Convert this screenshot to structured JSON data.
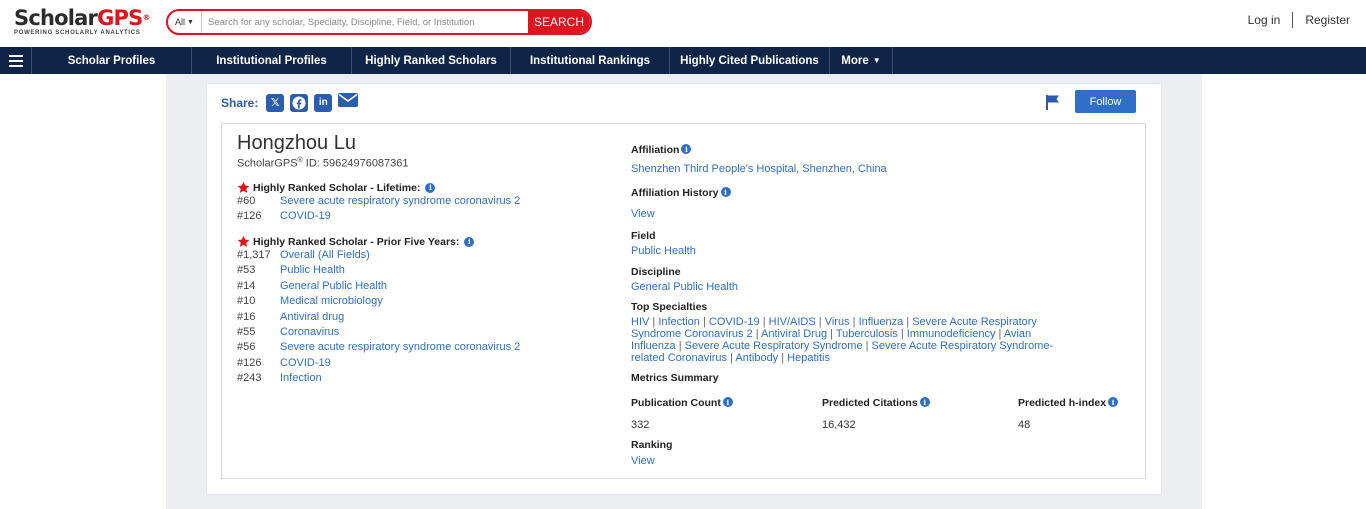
{
  "header": {
    "logo_scholar": "Scholar",
    "logo_gps": "GPS",
    "logo_reg": "®",
    "logo_tagline": "POWERING SCHOLARLY ANALYTICS",
    "search_category": "All",
    "search_placeholder": "Search for any scholar, Specialty, Discipline, Field, or Institution",
    "search_button": "SEARCH",
    "login": "Log in",
    "register": "Register"
  },
  "nav": {
    "items": [
      {
        "label": "Scholar Profiles"
      },
      {
        "label": "Institutional Profiles"
      },
      {
        "label": "Highly Ranked Scholars"
      },
      {
        "label": "Institutional Rankings"
      },
      {
        "label": "Highly Cited Publications"
      },
      {
        "label": "More"
      }
    ]
  },
  "share": {
    "label": "Share:",
    "follow": "Follow"
  },
  "profile": {
    "name": "Hongzhou Lu",
    "id_prefix": "ScholarGPS",
    "id_reg": "®",
    "id_rest": " ID: 59624976087361",
    "lifetime_heading": "Highly Ranked Scholar - Lifetime:",
    "lifetime": [
      {
        "rank": "#60",
        "topic": "Severe acute respiratory syndrome coronavirus 2"
      },
      {
        "rank": "#126",
        "topic": "COVID-19"
      }
    ],
    "prior_heading": "Highly Ranked Scholar - Prior Five Years:",
    "prior": [
      {
        "rank": "#1,317",
        "topic": "Overall (All Fields)"
      },
      {
        "rank": "#53",
        "topic": "Public Health"
      },
      {
        "rank": "#14",
        "topic": "General Public Health"
      },
      {
        "rank": "#10",
        "topic": "Medical microbiology"
      },
      {
        "rank": "#16",
        "topic": "Antiviral drug"
      },
      {
        "rank": "#55",
        "topic": "Coronavirus"
      },
      {
        "rank": "#56",
        "topic": "Severe acute respiratory syndrome coronavirus 2"
      },
      {
        "rank": "#126",
        "topic": "COVID-19"
      },
      {
        "rank": "#243",
        "topic": "Infection"
      }
    ]
  },
  "details": {
    "affiliation_label": "Affiliation",
    "affiliation": "Shenzhen Third People's Hospital, Shenzhen, China",
    "history_label": "Affiliation History",
    "history_link": "View",
    "field_label": "Field",
    "field": "Public Health",
    "discipline_label": "Discipline",
    "discipline": "General Public Health",
    "specialties_label": "Top Specialties",
    "specialties": [
      "HIV",
      "Infection",
      "COVID-19",
      "HIV/AIDS",
      "Virus",
      "Influenza",
      "Severe Acute Respiratory Syndrome Coronavirus 2",
      "Antiviral Drug",
      "Tuberculosis",
      "Immunodeficiency",
      "Avian Influenza",
      "Severe Acute Respiratory Syndrome",
      "Severe Acute Respiratory Syndrome-related Coronavirus",
      "Antibody",
      "Hepatitis"
    ],
    "metrics_label": "Metrics Summary",
    "pub_count_label": "Publication Count",
    "pub_count": "332",
    "pred_cit_label": "Predicted Citations",
    "pred_cit": "16,432",
    "pred_h_label": "Predicted h-index",
    "pred_h": "48",
    "ranking_label": "Ranking",
    "ranking_link": "View"
  },
  "colors": {
    "brand_red": "#e0141e",
    "nav_bg": "#0f2547",
    "link_blue": "#2f6fc7"
  }
}
